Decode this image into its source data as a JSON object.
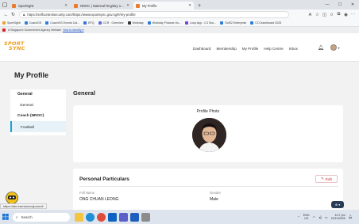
{
  "browser": {
    "tabs": [
      {
        "label": "SportSgNt",
        "active": false,
        "color": "#e97b2e"
      },
      {
        "label": "NROC | National Registry of Coac",
        "active": false,
        "color": "#e97b2e"
      },
      {
        "label": "My Profile",
        "active": true,
        "color": "#e97b2e"
      }
    ],
    "new_tab": "+",
    "url": "https://selfcontrolsecurity.com/https://www.sportsync.gov.sg/#/my-profile",
    "bookmarks": [
      "SportSgNt",
      "CoachGS",
      "CoachGS Events Cal...",
      "EFQ",
      "CCR - Overview",
      "Workday",
      "Workday Finance Us...",
      "Loop App - C3 Sou...",
      "SolS2 Enterprise",
      "CO Dashboard 2025"
    ],
    "gov_banner": "A Singapore Government Agency Website",
    "gov_link": "How to identify ▾"
  },
  "header": {
    "logo_line1": "SPORT",
    "logo_line2": "SYNC",
    "nav": [
      "Dashboard",
      "Membership",
      "My Profile",
      "Help Centre",
      "Inbox"
    ],
    "brand_color": "#f29d1f"
  },
  "page": {
    "title": "My Profile",
    "sidebar": {
      "heading": "General",
      "item_general": "General",
      "heading2": "Coach (NROC)",
      "item_football": "Football"
    },
    "section_title": "General",
    "photo_label": "Profile Photo",
    "particulars": {
      "title": "Personal Particulars",
      "edit_label": "Edit",
      "fields": [
        {
          "label": "Full Name",
          "value": "ONG CHUAN LEONG"
        },
        {
          "label": "Gender",
          "value": "Male"
        }
      ]
    },
    "accent_color": "#14a3d6"
  },
  "statusbar": {
    "url": "https://site.eserviceonly.com/#"
  },
  "taskbar": {
    "search_placeholder": "Search",
    "lang": "ENG",
    "lang2": "US",
    "time": "6:17 pm",
    "date": "22/10/2025"
  }
}
